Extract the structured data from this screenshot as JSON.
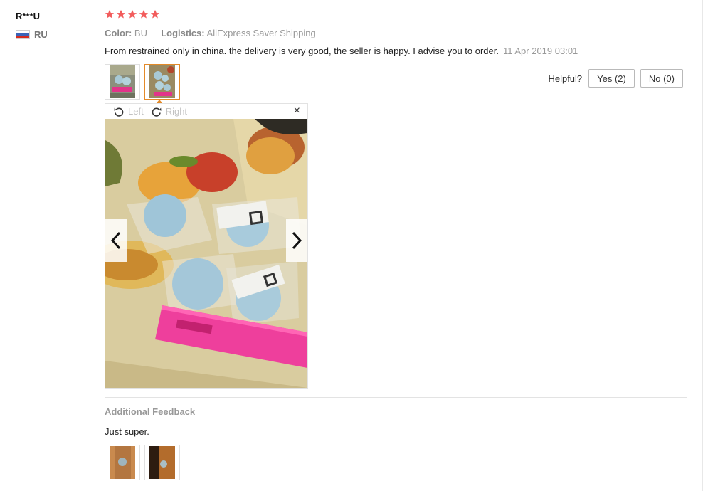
{
  "review": {
    "user_name": "R***U",
    "country_code": "RU",
    "rating": 5,
    "color_label": "Color:",
    "color_value": "BU",
    "logistics_label": "Logistics:",
    "logistics_value": "AliExpress Saver Shipping",
    "text": "From restrained only in china. the delivery is very good, the seller is happy. I advise you to order.",
    "date": "11 Apr 2019 03:01"
  },
  "helpful": {
    "label": "Helpful?",
    "yes_label": "Yes (2)",
    "no_label": "No (0)"
  },
  "viewer": {
    "rotate_left_label": "Left",
    "rotate_right_label": "Right",
    "close_label": "×"
  },
  "additional_feedback": {
    "title": "Additional Feedback",
    "text": "Just super."
  },
  "colors": {
    "star": "#f25c5c",
    "active_thumb": "#e48a28"
  },
  "icons": {
    "rotate_left": "rotate-left-icon",
    "rotate_right": "rotate-right-icon",
    "close": "close-icon",
    "prev": "chevron-left-icon",
    "next": "chevron-right-icon"
  }
}
